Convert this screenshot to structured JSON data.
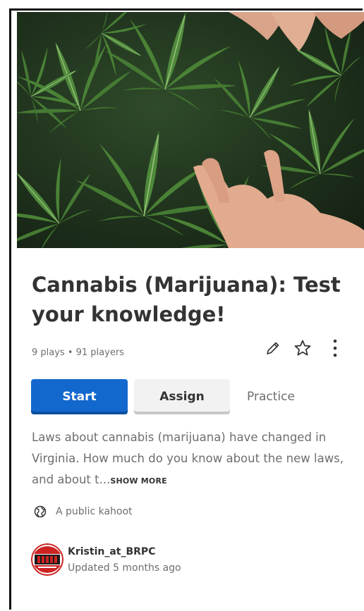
{
  "kahoot": {
    "title": "Cannabis (Marijuana): Test your knowledge!",
    "stats": "9 plays • 91 players",
    "actions": {
      "start_label": "Start",
      "assign_label": "Assign",
      "practice_label": "Practice"
    },
    "description": "Laws about cannabis (marijuana) have changed in Virginia. How much do you know about the new laws, and about t...",
    "show_more_label": "SHOW MORE",
    "visibility": "A public kahoot",
    "author": {
      "name": "Kristin_at_BRPC",
      "updated": "Updated 5 months ago"
    },
    "icons": {
      "edit": "pencil-icon",
      "favorite": "star-icon",
      "more": "kebab-menu-icon",
      "visibility": "globe-icon"
    }
  },
  "colors": {
    "primary": "#1368ce",
    "text": "#333333",
    "muted": "#6e6e6e"
  }
}
